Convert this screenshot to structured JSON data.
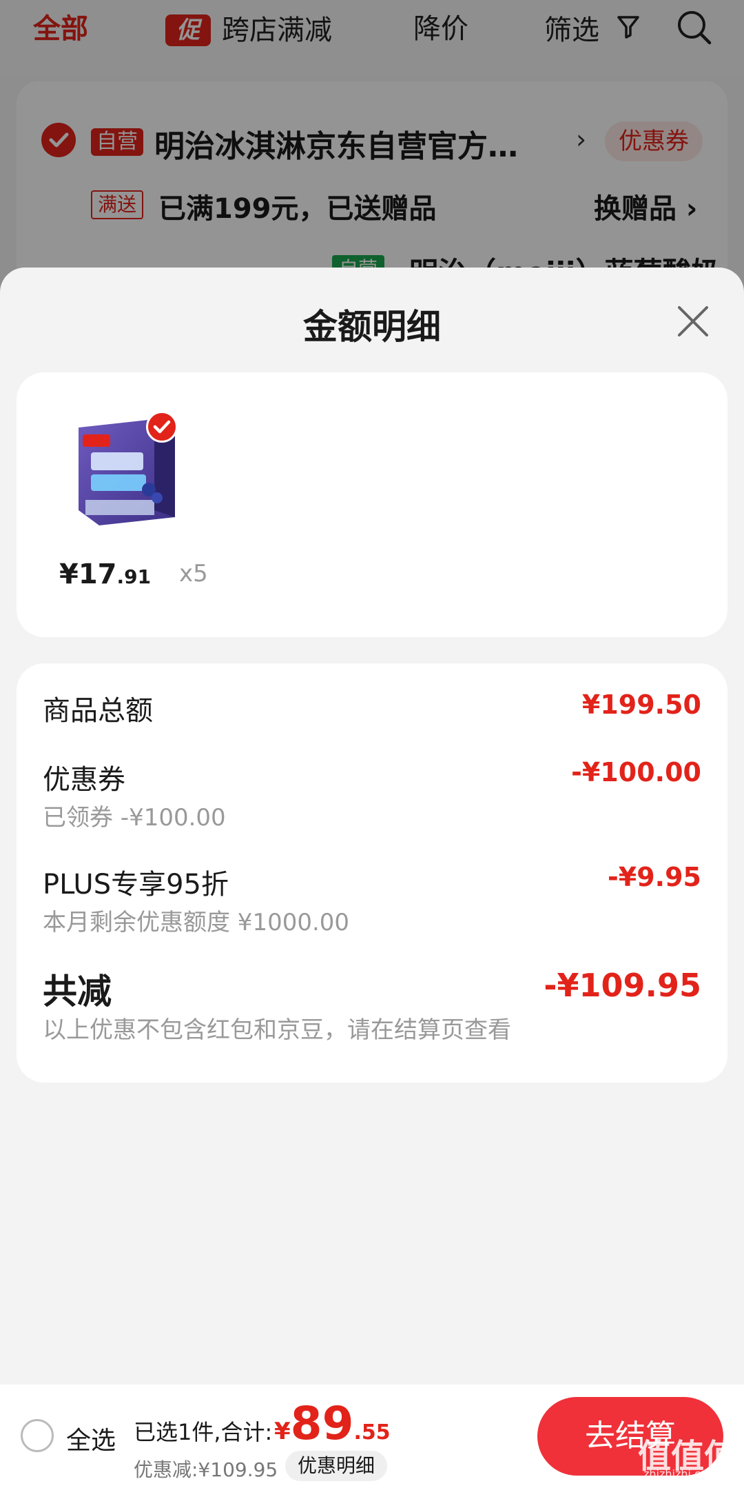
{
  "topbar": {
    "tab_all": "全部",
    "promo_badge": "促",
    "tab_cross_store": "跨店满减",
    "tab_price_drop": "降价",
    "tab_filter": "筛选"
  },
  "store": {
    "self_tag": "自营",
    "name": "明治冰淇淋京东自营官方…",
    "coupon_chip": "优惠券",
    "gift_tag": "满送",
    "gift_text": "已满199元，已送赠品",
    "gift_change": "换赠品 ›",
    "item_tag": "自营",
    "item_peek": "明治（meiji）蓝莓酸奶"
  },
  "sheet": {
    "title": "金额明细",
    "product": {
      "price_int": "¥17",
      "price_dec": ".91",
      "qty": "x5"
    },
    "rows": {
      "goods_total_label": "商品总额",
      "goods_total_value": "¥199.50",
      "coupon_label": "优惠券",
      "coupon_sub": "已领券 -¥100.00",
      "coupon_value": "-¥100.00",
      "plus_label": "PLUS专享95折",
      "plus_sub": "本月剩余优惠额度 ¥1000.00",
      "plus_value": "-¥9.95",
      "total_label": "共减",
      "total_value": "-¥109.95",
      "total_note": "以上优惠不包含红包和京豆，请在结算页查看"
    }
  },
  "checkout": {
    "select_all": "全选",
    "selected_text": "已选1件,合计:",
    "currency": "¥",
    "total_int": "89",
    "total_dec": ".55",
    "discount_text": "优惠减:¥109.95",
    "detail_chip": "优惠明细",
    "checkout_button": "去结算",
    "watermark": "值值值",
    "watermark_sub": "zhizhizhi.com"
  },
  "colors": {
    "accent": "#e2231a",
    "checkout_button": "#f0313a",
    "sheet_bg": "#f3f3f3"
  }
}
